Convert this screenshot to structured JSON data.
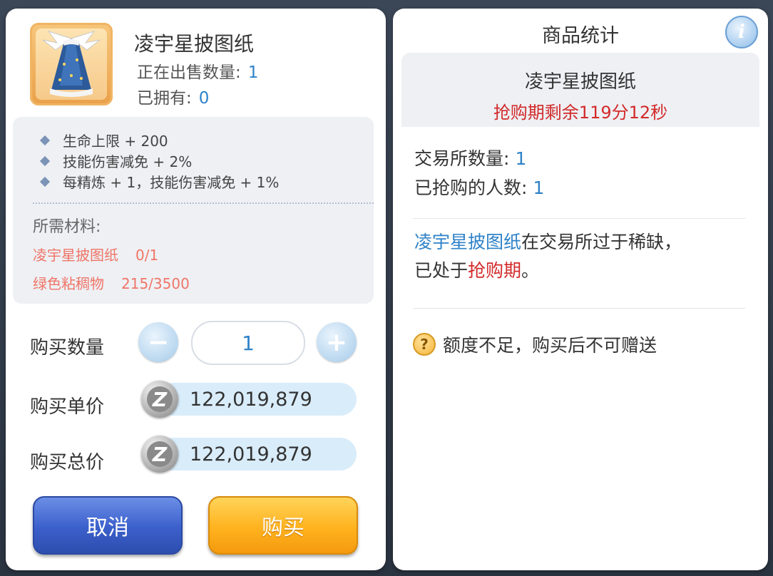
{
  "item": {
    "name": "凌宇星披图纸",
    "selling_label": "正在出售数量:",
    "selling_value": "1",
    "owned_label": "已拥有:",
    "owned_value": "0"
  },
  "attributes": [
    "生命上限 + 200",
    "技能伤害减免 + 2%",
    "每精炼 + 1，技能伤害减免 + 1%"
  ],
  "materials": {
    "title": "所需材料:",
    "list": [
      {
        "name": "凌宇星披图纸",
        "qty": "0/1"
      },
      {
        "name": "绿色粘稠物",
        "qty": "215/3500"
      }
    ]
  },
  "purchase": {
    "qty_label": "购买数量",
    "qty_value": "1",
    "unit_label": "购买单价",
    "unit_price": "122,019,879",
    "total_label": "购买总价",
    "total_price": "122,019,879",
    "minus_symbol": "−",
    "plus_symbol": "+",
    "cancel_label": "取消",
    "buy_label": "购买",
    "currency_symbol": "Z"
  },
  "stats": {
    "title": "商品统计",
    "info_symbol": "i",
    "item_name": "凌宇星披图纸",
    "timer": "抢购期剩余119分12秒",
    "exchange_label": "交易所数量:",
    "exchange_value": "1",
    "buyers_label": "已抢购的人数:",
    "buyers_value": "1",
    "desc_item": "凌宇星披图纸",
    "desc_mid": "在交易所过于稀缺，",
    "desc_line2_pre": "已处于",
    "desc_highlight": "抢购期",
    "desc_line2_post": "。",
    "warning_symbol": "?",
    "warning": "额度不足，购买后不可赠送"
  },
  "colors": {
    "accent_blue": "#2f82c8",
    "alert_red": "#d22a2a",
    "material_red": "#f07567",
    "cancel_blue": "#3b5fcb",
    "buy_orange": "#ffb21e"
  },
  "icons": [
    "item-thumbnail-cape",
    "minus-icon",
    "plus-icon",
    "zeny-coin-icon",
    "info-icon",
    "question-icon",
    "diamond-bullet-icon"
  ]
}
